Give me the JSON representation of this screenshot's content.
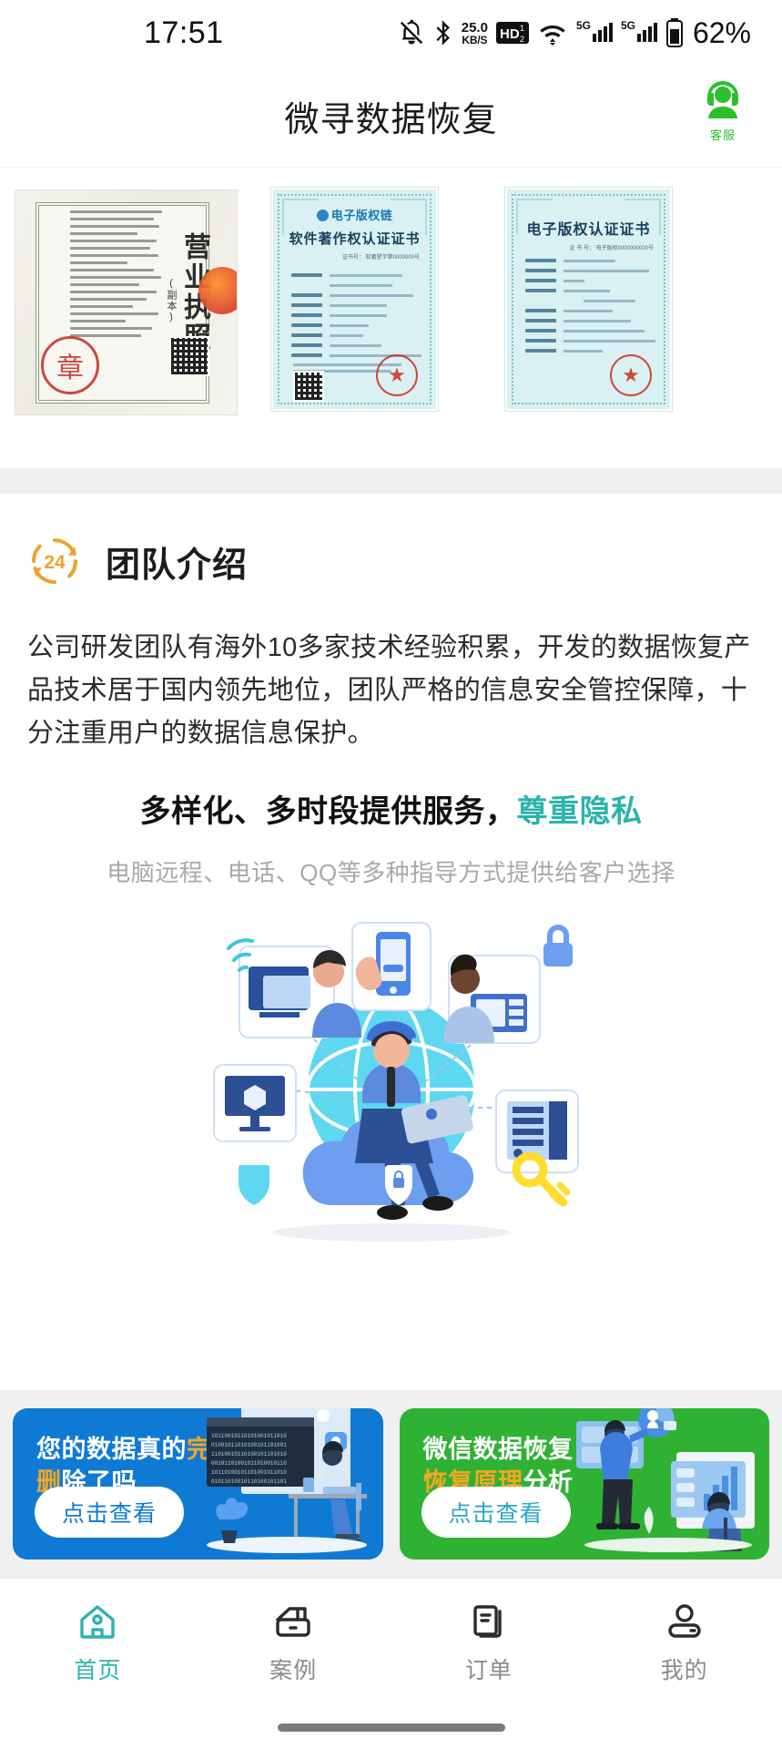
{
  "status_bar": {
    "time": "17:51",
    "network_speed": "25.0",
    "network_speed_unit": "KB/S",
    "hd_badge": "HD",
    "hd_sub": "1 2",
    "signal_label_1": "5G",
    "signal_label_2": "5G",
    "battery": "62%",
    "icons": [
      "mute-icon",
      "bluetooth-icon",
      "network-speed-icon",
      "hd-voice-icon",
      "wifi-icon",
      "cellular-5g-icon-1",
      "cellular-5g-icon-2",
      "battery-icon"
    ]
  },
  "header": {
    "title": "微寻数据恢复",
    "service_label": "客服"
  },
  "certificates": [
    {
      "name": "business-license",
      "title_vertical": "营业执照",
      "subtitle_vertical": "(副本)",
      "seal_text": "章",
      "stamp": "official-stamp"
    },
    {
      "name": "software-copyright-certificate",
      "logo_text": "电子版权链",
      "title": "软件著作权认证证书",
      "cert_no": "证书号： 软著登字第0000000号",
      "seal_text": "★"
    },
    {
      "name": "electronic-copyright-certificate",
      "title": "电子版权认证证书",
      "cert_no": "证 书 号： 电子版权0000000000号",
      "seal_text": "★"
    }
  ],
  "team_section": {
    "icon_label": "24",
    "title": "团队介绍",
    "body": "公司研发团队有海外10多家技术经验积累，开发的数据恢复产品技术居于国内领先地位，团队严格的信息安全管控保障，十分注重用户的数据信息保护。",
    "headline_main": "多样化、多时段提供服务，",
    "headline_accent": "尊重隐私",
    "subtitle": "电脑远程、电话、QQ等多种指导方式提供给客户选择",
    "illustration": "remote-support-illustration"
  },
  "promos": [
    {
      "name": "data-deletion-promo",
      "line1_a": "您的数据真的",
      "line1_b": "完全",
      "line2_a": "删",
      "line2_b": "除了吗",
      "button": "点击查看",
      "background": "#0f7ad4",
      "highlight": "#f5a623"
    },
    {
      "name": "wechat-recovery-promo",
      "line1_a": "微信数据恢复",
      "line1_b": "",
      "line2_a": "恢复原理",
      "line2_b": "分析",
      "button": "点击查看",
      "background": "#2fb234",
      "highlight": "#f5a623"
    }
  ],
  "tabbar": {
    "active_color": "#2bb3ad",
    "inactive_color": "#8a8a8a",
    "items": [
      {
        "label": "首页",
        "icon": "home-icon",
        "active": true
      },
      {
        "label": "案例",
        "icon": "briefcase-icon",
        "active": false
      },
      {
        "label": "订单",
        "icon": "orders-icon",
        "active": false
      },
      {
        "label": "我的",
        "icon": "profile-icon",
        "active": false
      }
    ]
  }
}
